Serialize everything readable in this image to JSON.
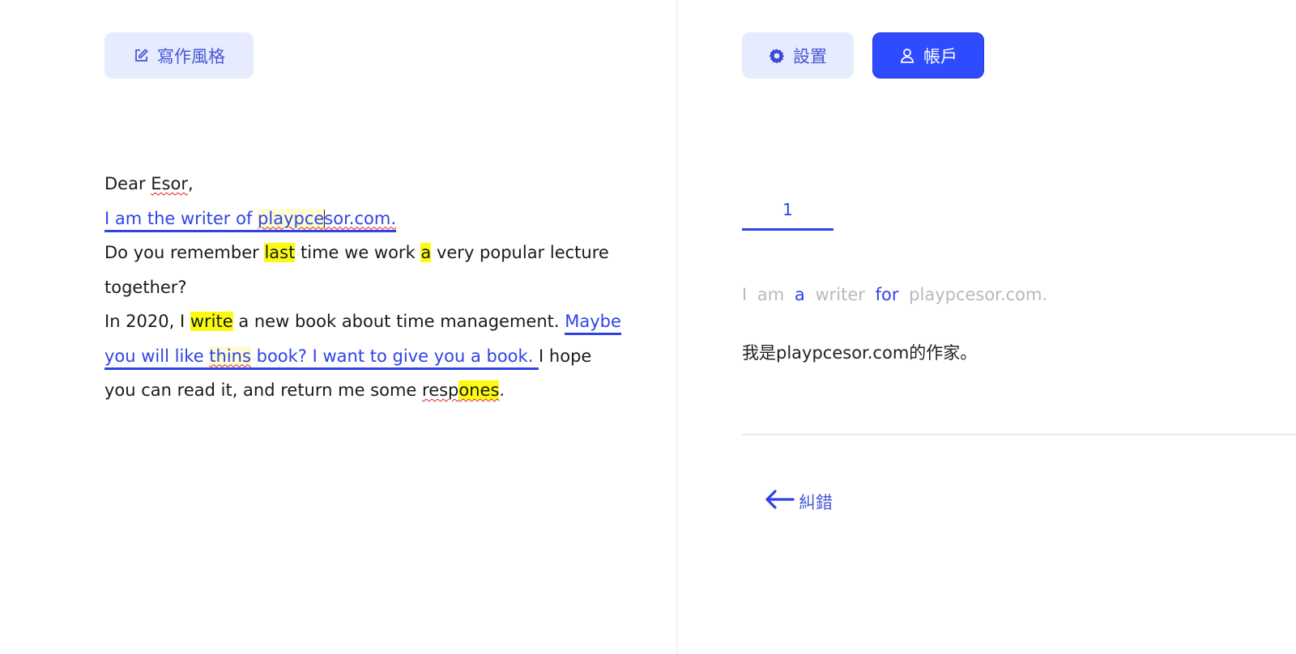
{
  "toolbar": {
    "writing_style_label": "寫作風格",
    "settings_label": "設置",
    "account_label": "帳戶"
  },
  "editor": {
    "salutation": "Dear ",
    "salutation_name": "Esor",
    "salutation_comma": ",",
    "sentence1_a": "I am the writer of ",
    "sentence1_b": "playpce",
    "sentence1_c": "sor.com.",
    "p2_a": "Do you remember ",
    "p2_hl1": "last",
    "p2_b": " time we work ",
    "p2_hl2": "a",
    "p2_c": " very popular lecture",
    "p2_d": "together?",
    "p3_a": "In 2020, I ",
    "p3_hl": "write",
    "p3_b": " a new book about time management. ",
    "p3_blue1": "Maybe ",
    "p3_blue2a": "you will like ",
    "p3_blue2_err": "thins",
    "p3_blue2b": " book?   I want to give you a book.  ",
    "p3_c": "I hope",
    "p3_d": "you can read it, and return me some ",
    "p3_err_a": "resp",
    "p3_err_b": "ones",
    "p3_end": "."
  },
  "panel": {
    "tab_label": "1",
    "suggestion": {
      "w1": "I",
      "w2": "am",
      "w3_inserted": "a",
      "w4": "writer",
      "w5_inserted": "for",
      "w6": "playpcesor.com."
    },
    "translation": "我是playpcesor.com的作家。",
    "back_label": "糾錯"
  },
  "colors": {
    "accent": "#2f43e6",
    "button_light_bg": "#e6ebfd",
    "account_bg": "#2f4bff",
    "highlight": "#fbfb12",
    "spell_error": "#e01f1f"
  },
  "icons": {
    "writing_style": "edit-icon",
    "settings": "gear-icon",
    "account": "user-icon",
    "back": "arrow-left-icon"
  }
}
